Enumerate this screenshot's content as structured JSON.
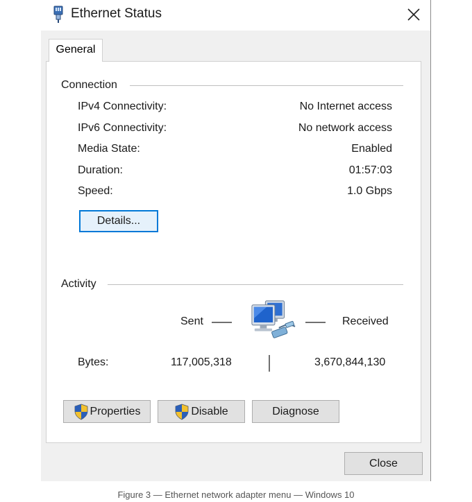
{
  "window": {
    "title": "Ethernet Status",
    "title_icon": "network-adapter-icon",
    "close_icon": "close-icon"
  },
  "tabs": [
    {
      "label": "General",
      "selected": true
    }
  ],
  "connection": {
    "group_label": "Connection",
    "rows": [
      {
        "label": "IPv4 Connectivity:",
        "value": "No Internet access"
      },
      {
        "label": "IPv6 Connectivity:",
        "value": "No network access"
      },
      {
        "label": "Media State:",
        "value": "Enabled"
      },
      {
        "label": "Duration:",
        "value": "01:57:03"
      },
      {
        "label": "Speed:",
        "value": "1.0 Gbps"
      }
    ],
    "details_button": "Details..."
  },
  "activity": {
    "group_label": "Activity",
    "sent_label": "Sent",
    "received_label": "Received",
    "bytes_label": "Bytes:",
    "bytes_sent": "117,005,318",
    "bytes_received": "3,670,844,130",
    "network_icon": "network-computers-icon"
  },
  "buttons": {
    "properties": "Properties",
    "disable": "Disable",
    "diagnose": "Diagnose",
    "close": "Close",
    "shield_icon": "uac-shield-icon"
  },
  "colors": {
    "focus_border": "#0078d7",
    "dialog_background": "#f0f0f0"
  },
  "caption": "Figure 3 — Ethernet network adapter menu — Windows 10"
}
